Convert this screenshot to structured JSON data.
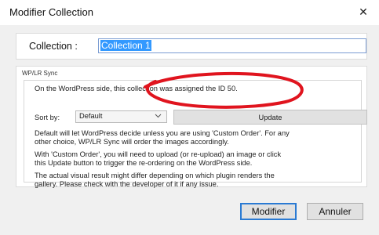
{
  "window": {
    "title": "Modifier Collection",
    "close_glyph": "✕"
  },
  "collection": {
    "label": "Collection :",
    "value": "Collection 1"
  },
  "sync": {
    "group_label": "WP/LR Sync",
    "assigned_text": "On the WordPress side, this collection was assigned the ID 50.",
    "sort_label": "Sort by:",
    "sort_value": "Default",
    "update_label": "Update",
    "paragraph1_line1": "Default will let WordPress decide unless you are using 'Custom Order'. For any",
    "paragraph1_line2": "other choice, WP/LR Sync will order the images accordingly.",
    "paragraph2_line1": "With 'Custom Order', you will need to upload (or re-upload) an image or click",
    "paragraph2_line2": "this Update button to trigger the re-ordering on the WordPress side.",
    "paragraph3_line1": "The actual visual result might differ depending on which plugin renders the",
    "paragraph3_line2": "gallery. Please check with the developer of it if any issue."
  },
  "buttons": {
    "modifier": "Modifier",
    "annuler": "Annuler"
  },
  "colors": {
    "highlight_circle": "#e0141e",
    "selection": "#3399ff",
    "primary_border": "#2a7ad3"
  }
}
